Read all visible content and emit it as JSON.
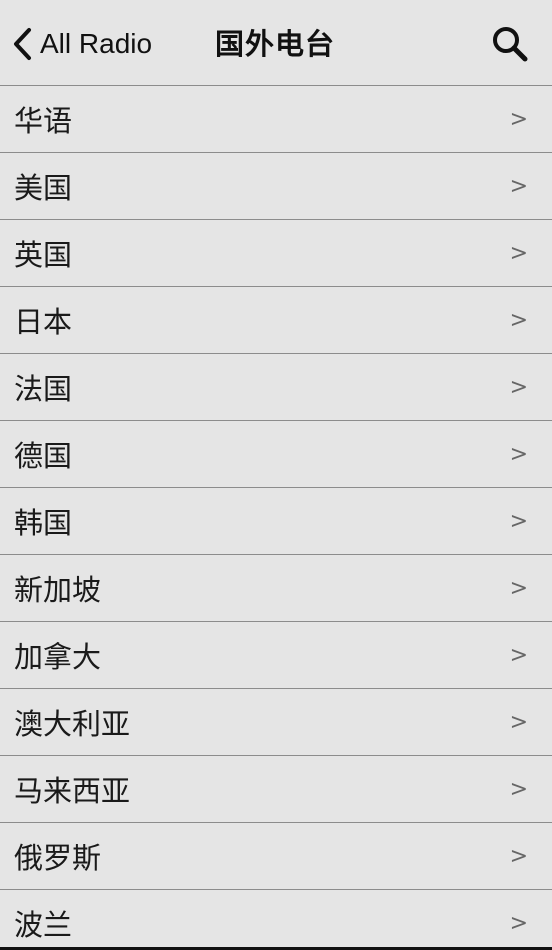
{
  "header": {
    "back_label": "All Radio",
    "title": "国外电台"
  },
  "icons": {
    "back": "chevron-left-icon",
    "search": "search-icon",
    "row_arrow": "chevron-right-icon"
  },
  "list": {
    "arrow_glyph": ">",
    "items": [
      {
        "label": "华语"
      },
      {
        "label": "美国"
      },
      {
        "label": "英国"
      },
      {
        "label": "日本"
      },
      {
        "label": "法国"
      },
      {
        "label": "德国"
      },
      {
        "label": "韩国"
      },
      {
        "label": "新加坡"
      },
      {
        "label": "加拿大"
      },
      {
        "label": "澳大利亚"
      },
      {
        "label": "马来西亚"
      },
      {
        "label": "俄罗斯"
      },
      {
        "label": "波兰"
      }
    ]
  }
}
